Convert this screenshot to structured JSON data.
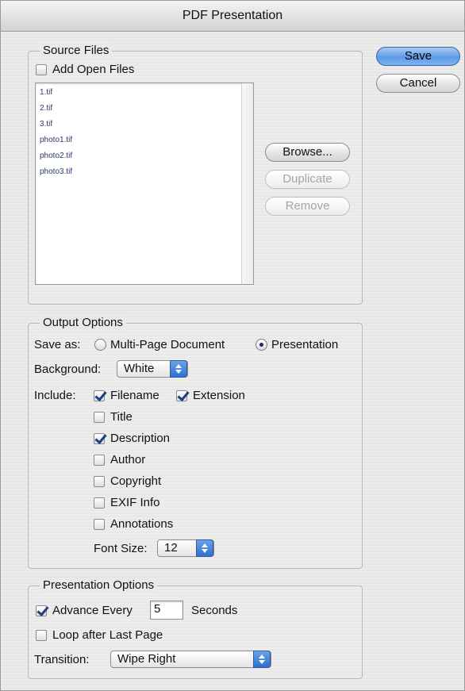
{
  "window": {
    "title": "PDF Presentation"
  },
  "source_files": {
    "legend": "Source Files",
    "add_open_files": {
      "label": "Add Open Files",
      "checked": false
    },
    "files": [
      "1.tif",
      "2.tif",
      "3.tif",
      "photo1.tif",
      "photo2.tif",
      "photo3.tif"
    ],
    "buttons": {
      "browse": "Browse...",
      "duplicate": "Duplicate",
      "remove": "Remove"
    }
  },
  "actions": {
    "save": "Save",
    "cancel": "Cancel"
  },
  "output_options": {
    "legend": "Output Options",
    "save_as_label": "Save as:",
    "save_as_options": [
      {
        "label": "Multi-Page Document",
        "selected": false
      },
      {
        "label": "Presentation",
        "selected": true
      }
    ],
    "background_label": "Background:",
    "background_value": "White",
    "include_label": "Include:",
    "include": {
      "filename": {
        "label": "Filename",
        "checked": true
      },
      "extension": {
        "label": "Extension",
        "checked": true
      },
      "title": {
        "label": "Title",
        "checked": false
      },
      "description": {
        "label": "Description",
        "checked": true
      },
      "author": {
        "label": "Author",
        "checked": false
      },
      "copyright": {
        "label": "Copyright",
        "checked": false
      },
      "exif": {
        "label": "EXIF Info",
        "checked": false
      },
      "annotations": {
        "label": "Annotations",
        "checked": false
      }
    },
    "font_size_label": "Font Size:",
    "font_size_value": "12"
  },
  "presentation_options": {
    "legend": "Presentation Options",
    "advance": {
      "label": "Advance Every",
      "checked": true
    },
    "seconds_value": "5",
    "seconds_label": "Seconds",
    "loop": {
      "label": "Loop after Last Page",
      "checked": false
    },
    "transition_label": "Transition:",
    "transition_value": "Wipe Right"
  },
  "colors": {
    "primary_button": "#5d99e6",
    "checkmark": "#1e3f7e"
  }
}
